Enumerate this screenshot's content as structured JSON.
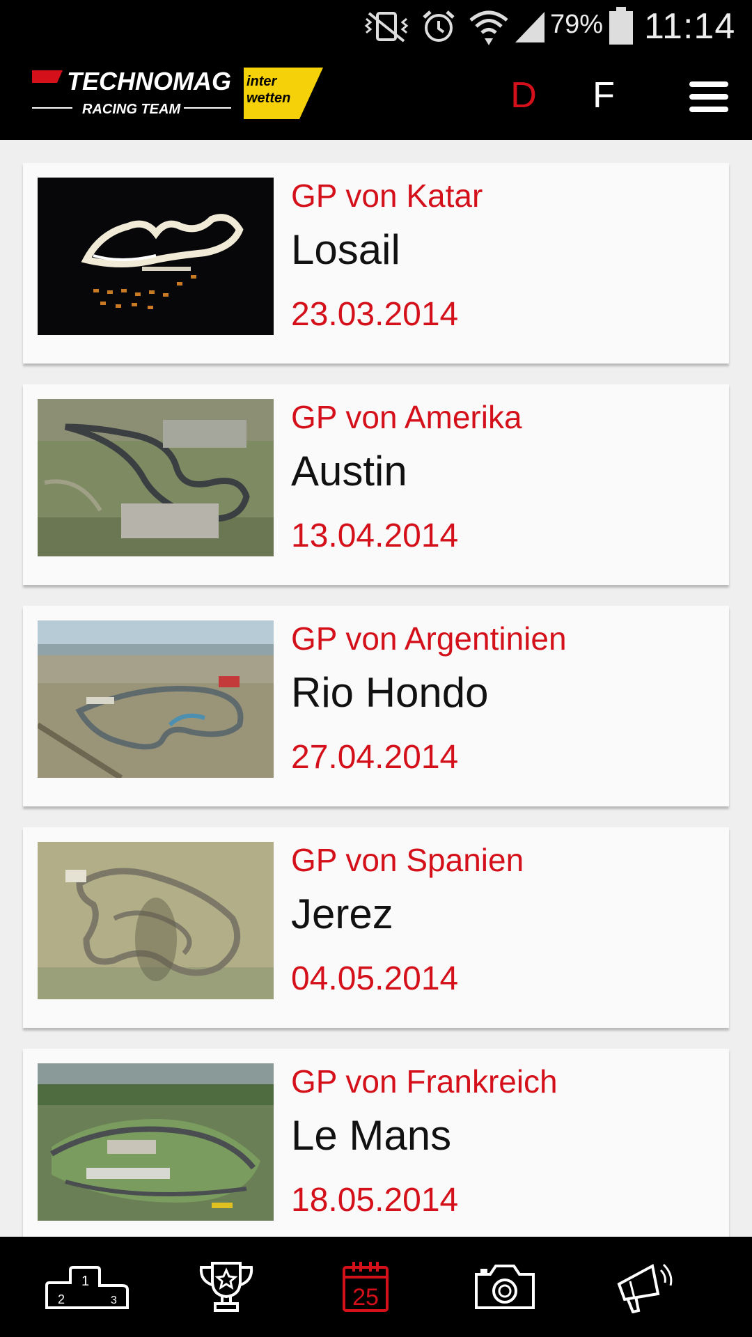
{
  "status_bar": {
    "battery_percent": "79%",
    "time": "11:14",
    "icons": [
      "vibrate-mute-icon",
      "alarm-icon",
      "wifi-icon",
      "signal-icon",
      "battery-icon"
    ]
  },
  "header": {
    "logo": {
      "brand": "TECHNOMAG",
      "subtitle": "RACING TEAM",
      "sponsor_line1": "inter",
      "sponsor_line2": "wetten"
    },
    "languages": [
      {
        "code": "D",
        "active": true
      },
      {
        "code": "F",
        "active": false
      }
    ],
    "menu_icon": "hamburger-menu-icon"
  },
  "races": [
    {
      "gp": "GP von Katar",
      "venue": "Losail",
      "date": "23.03.2014"
    },
    {
      "gp": "GP von Amerika",
      "venue": "Austin",
      "date": "13.04.2014"
    },
    {
      "gp": "GP von Argentinien",
      "venue": "Rio Hondo",
      "date": "27.04.2014"
    },
    {
      "gp": "GP von Spanien",
      "venue": "Jerez",
      "date": "04.05.2014"
    },
    {
      "gp": "GP von Frankreich",
      "venue": "Le Mans",
      "date": "18.05.2014"
    }
  ],
  "bottom_nav": [
    {
      "icon": "podium-icon",
      "labels": [
        "2",
        "1",
        "3"
      ],
      "active": false
    },
    {
      "icon": "trophy-icon",
      "active": false
    },
    {
      "icon": "calendar-icon",
      "label": "25",
      "active": true
    },
    {
      "icon": "camera-icon",
      "active": false
    },
    {
      "icon": "megaphone-icon",
      "active": false
    }
  ],
  "colors": {
    "accent_red": "#d4101a",
    "bar_bg": "#000000",
    "list_bg": "#efefef",
    "card_bg": "#fafafa",
    "sponsor_yellow": "#f5d10a"
  }
}
